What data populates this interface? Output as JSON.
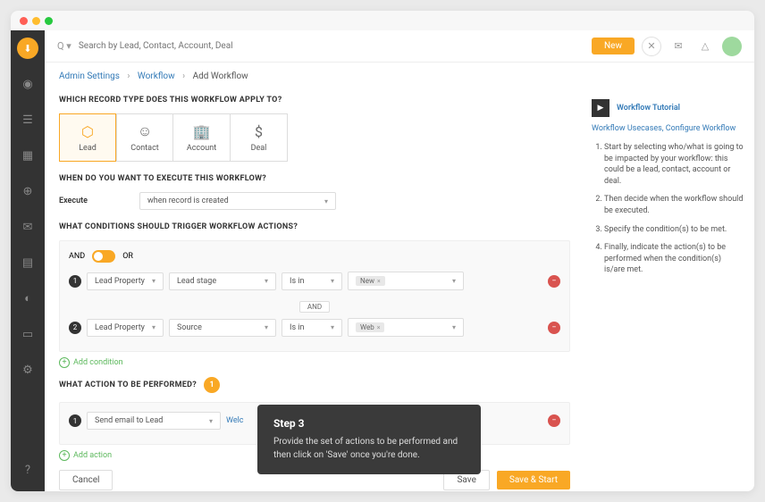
{
  "topbar": {
    "search_placeholder": "Search by Lead, Contact, Account, Deal",
    "new_button": "New"
  },
  "breadcrumb": {
    "items": [
      "Admin Settings",
      "Workflow"
    ],
    "current": "Add Workflow"
  },
  "sections": {
    "record_type_label": "WHICH RECORD TYPE DOES THIS WORKFLOW APPLY TO?",
    "execute_label": "WHEN DO YOU WANT TO EXECUTE THIS WORKFLOW?",
    "conditions_label": "WHAT CONDITIONS SHOULD TRIGGER WORKFLOW ACTIONS?",
    "action_label": "WHAT ACTION TO BE PERFORMED?"
  },
  "record_types": [
    {
      "label": "Lead",
      "selected": true
    },
    {
      "label": "Contact",
      "selected": false
    },
    {
      "label": "Account",
      "selected": false
    },
    {
      "label": "Deal",
      "selected": false
    }
  ],
  "execute": {
    "field_label": "Execute",
    "value": "when record is created"
  },
  "conditions": {
    "logic_and": "AND",
    "logic_or": "OR",
    "rows": [
      {
        "property": "Lead Property",
        "field": "Lead stage",
        "op": "Is in",
        "tag": "New"
      },
      {
        "property": "Lead Property",
        "field": "Source",
        "op": "Is in",
        "tag": "Web"
      }
    ],
    "divider": "AND",
    "add": "Add condition"
  },
  "actions": {
    "rows": [
      {
        "type": "Send email to Lead",
        "link": "Welc"
      }
    ],
    "add": "Add action"
  },
  "footer": {
    "cancel": "Cancel",
    "save": "Save",
    "save_start": "Save & Start"
  },
  "tooltip": {
    "badge": "1",
    "title": "Step 3",
    "body": "Provide the set of actions to be performed and then click on 'Save' once you're done."
  },
  "help": {
    "title": "Workflow Tutorial",
    "links": "Workflow Usecases, Configure Workflow",
    "steps": [
      "Start by selecting who/what is going to be impacted by your workflow: this could be a lead, contact, account or deal.",
      "Then decide when the workflow should be executed.",
      "Specify the condition(s) to be met.",
      "Finally, indicate the action(s) to be performed when the condition(s) is/are met."
    ]
  }
}
